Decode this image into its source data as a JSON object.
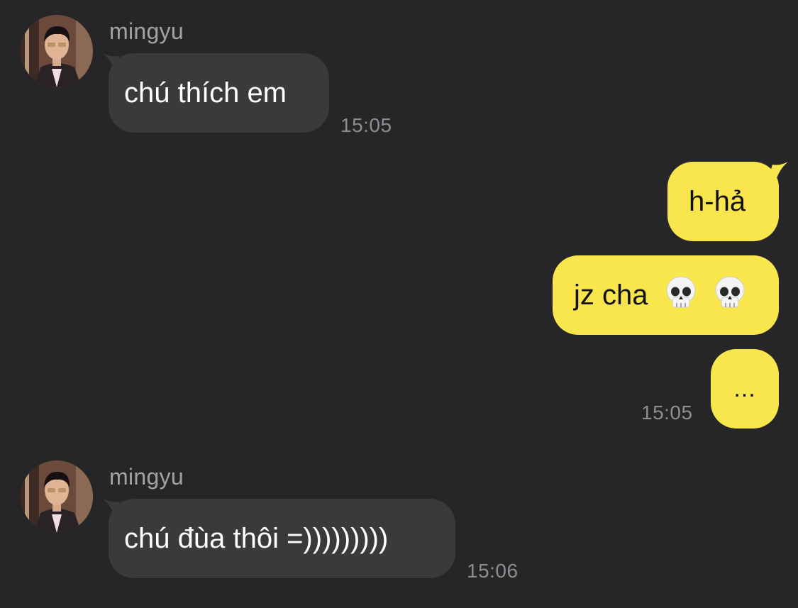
{
  "messages": [
    {
      "direction": "incoming",
      "sender": "mingyu",
      "text": "chú thích em",
      "time": "15:05"
    },
    {
      "direction": "outgoing",
      "text": "h-hả"
    },
    {
      "direction": "outgoing",
      "text": "jz cha",
      "emoji": [
        "skull-emoji",
        "skull-emoji"
      ]
    },
    {
      "direction": "outgoing",
      "text": "...",
      "time": "15:05"
    },
    {
      "direction": "incoming",
      "sender": "mingyu",
      "text": "chú đùa thôi =)))))))))",
      "time": "15:06"
    }
  ],
  "colors": {
    "background": "#262628",
    "incoming_bubble": "#3a3a3c",
    "outgoing_bubble": "#f9e54c",
    "timestamp": "#8e8e92",
    "sender_name": "#a3a3a6"
  }
}
